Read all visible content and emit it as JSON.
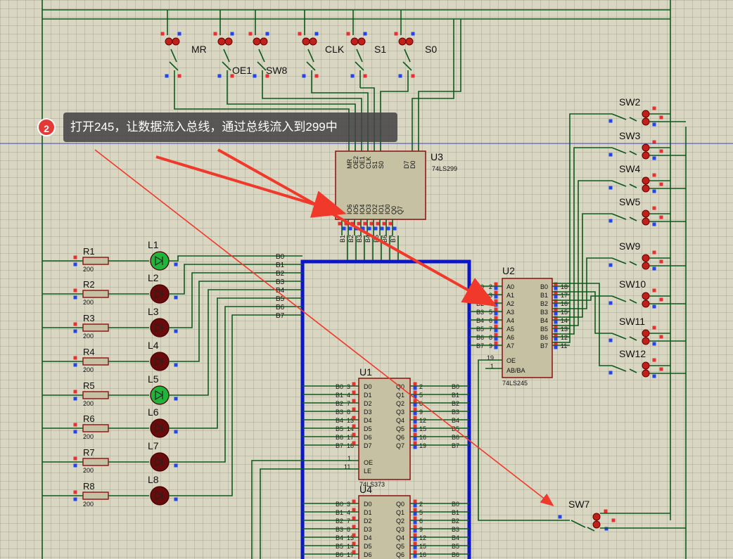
{
  "step": {
    "number": "2",
    "text": "打开245，让数据流入总线，通过总线流入到299中"
  },
  "switches_top": [
    "MR",
    "OE1",
    "SW8",
    "CLK",
    "S1",
    "S0"
  ],
  "switches_right": [
    "SW2",
    "SW3",
    "SW4",
    "SW5",
    "SW9",
    "SW10",
    "SW11",
    "SW12"
  ],
  "switch_bottom": "SW7",
  "u3": {
    "ref": "U3",
    "part": "74LS299",
    "top_pins": [
      "MR",
      "OE2",
      "OE1",
      "CLK",
      "S1",
      "S0",
      "D7",
      "D0"
    ],
    "io_pins": [
      "IO6",
      "IO5",
      "IO4",
      "IO3",
      "IO2",
      "IO1",
      "IO0",
      "Q0",
      "Q7"
    ],
    "bottom_bus": [
      "B1",
      "B2",
      "B3",
      "B4",
      "B5",
      "B6",
      "B7"
    ]
  },
  "u2": {
    "ref": "U2",
    "part": "74LS245",
    "a_pins": [
      "A0",
      "A1",
      "A2",
      "A3",
      "A4",
      "A5",
      "A6",
      "A7"
    ],
    "b_pins": [
      "B0",
      "B1",
      "B2",
      "B3",
      "B4",
      "B5",
      "B6",
      "B7"
    ],
    "ctrl": [
      "OE",
      "AB/BA"
    ],
    "left_nums": [
      "2",
      "3",
      "4",
      "5",
      "6",
      "7",
      "8",
      "9"
    ],
    "right_nums": [
      "18",
      "17",
      "16",
      "15",
      "14",
      "13",
      "12",
      "11"
    ],
    "ctrl_nums": [
      "19",
      "1"
    ]
  },
  "u1": {
    "ref": "U1",
    "part": "74LS373",
    "d_pins": [
      "D0",
      "D1",
      "D2",
      "D3",
      "D4",
      "D5",
      "D6",
      "D7"
    ],
    "q_pins": [
      "Q0",
      "Q1",
      "Q2",
      "Q3",
      "Q4",
      "Q5",
      "Q6",
      "Q7"
    ],
    "ctrl": [
      "OE",
      "LE"
    ],
    "left_nums": [
      "3",
      "4",
      "7",
      "8",
      "13",
      "14",
      "17",
      "18"
    ],
    "right_nums": [
      "2",
      "5",
      "6",
      "9",
      "12",
      "15",
      "16",
      "19"
    ],
    "ctrl_nums": [
      "1",
      "11"
    ]
  },
  "u4": {
    "ref": "U4",
    "d_pins": [
      "D0",
      "D1",
      "D2",
      "D3",
      "D4",
      "D5",
      "D6"
    ],
    "q_pins": [
      "Q0",
      "Q1",
      "Q2",
      "Q3",
      "Q4",
      "Q5",
      "Q6"
    ]
  },
  "bus_labels": [
    "B0",
    "B1",
    "B2",
    "B3",
    "B4",
    "B5",
    "B6",
    "B7"
  ],
  "resistors": [
    {
      "ref": "R1",
      "value": "200"
    },
    {
      "ref": "R2",
      "value": "200"
    },
    {
      "ref": "R3",
      "value": "200"
    },
    {
      "ref": "R4",
      "value": "200"
    },
    {
      "ref": "R5",
      "value": "200"
    },
    {
      "ref": "R6",
      "value": "200"
    },
    {
      "ref": "R7",
      "value": "200"
    },
    {
      "ref": "R8",
      "value": "200"
    }
  ],
  "leds": [
    {
      "ref": "L1",
      "on": true
    },
    {
      "ref": "L2",
      "on": false
    },
    {
      "ref": "L3",
      "on": false
    },
    {
      "ref": "L4",
      "on": false
    },
    {
      "ref": "L5",
      "on": true
    },
    {
      "ref": "L6",
      "on": false
    },
    {
      "ref": "L7",
      "on": false
    },
    {
      "ref": "L8",
      "on": false
    }
  ],
  "colors": {
    "wire": "#0d5a1c",
    "bus": "#0a16c8",
    "chip_fill": "#c5c1a2",
    "chip_border": "#8b0f0f",
    "led_on": "#22b43a",
    "led_off": "#6b0a0a",
    "arrow": "#f0382b",
    "pin_red": "#e83030",
    "pin_blue": "#2244ee"
  }
}
